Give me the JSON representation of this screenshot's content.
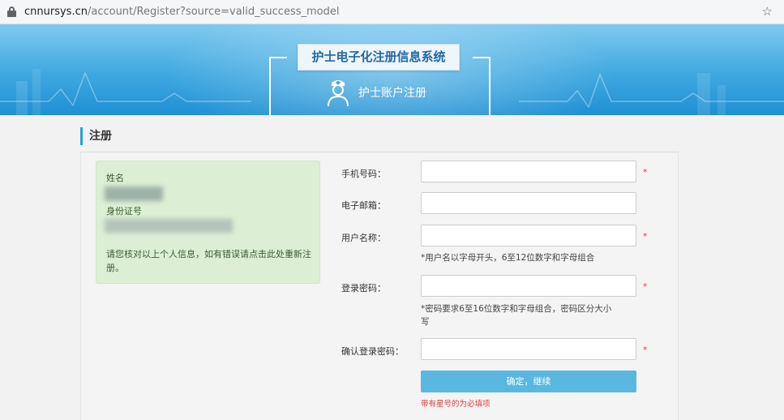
{
  "browser": {
    "url_host": "cnnursys.cn",
    "url_path": "/account/Register?source=valid_success_model"
  },
  "banner": {
    "title": "护士电子化注册信息系统",
    "subtitle": "护士账户注册"
  },
  "section": {
    "title": "注册"
  },
  "info_box": {
    "name_label": "姓名",
    "id_label": "身份证号",
    "note": "请您核对以上个人信息，如有错误请点击此处重新注册。"
  },
  "form": {
    "phone_label": "手机号码：",
    "email_label": "电子邮箱：",
    "username_label": "用户名称：",
    "username_hint": "*用户名以字母开头，6至12位数字和字母组合",
    "password_label": "登录密码：",
    "password_hint_1": "*密码要求6至16位数字和字母组合，密码区分大小",
    "password_hint_2": "写",
    "confirm_label": "确认登录密码：",
    "required_mark": "*",
    "submit_label": "确定，继续",
    "required_note": "带有星号的为必填项"
  }
}
